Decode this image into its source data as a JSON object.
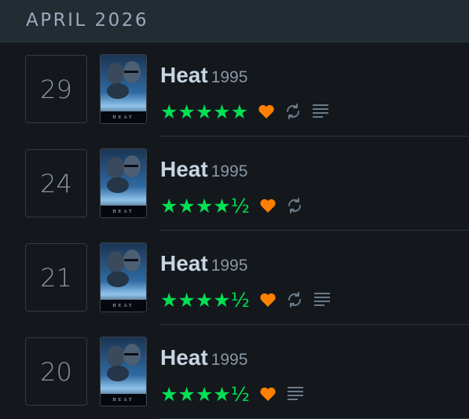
{
  "month": {
    "title": "APRIL 2026"
  },
  "colors": {
    "star": "#00e054",
    "heart": "#ff8000",
    "muted": "#6b7a8a"
  },
  "entries": [
    {
      "day": "29",
      "title": "Heat",
      "year": "1995",
      "rating_text": "★★★★★",
      "rating": 5,
      "liked": true,
      "rewatch": true,
      "review": true,
      "poster_title": "HEAT"
    },
    {
      "day": "24",
      "title": "Heat",
      "year": "1995",
      "rating_text": "★★★★½",
      "rating": 4.5,
      "liked": true,
      "rewatch": true,
      "review": false,
      "poster_title": "HEAT"
    },
    {
      "day": "21",
      "title": "Heat",
      "year": "1995",
      "rating_text": "★★★★½",
      "rating": 4.5,
      "liked": true,
      "rewatch": true,
      "review": true,
      "poster_title": "HEAT"
    },
    {
      "day": "20",
      "title": "Heat",
      "year": "1995",
      "rating_text": "★★★★½",
      "rating": 4.5,
      "liked": true,
      "rewatch": false,
      "review": true,
      "poster_title": "HEAT"
    }
  ]
}
